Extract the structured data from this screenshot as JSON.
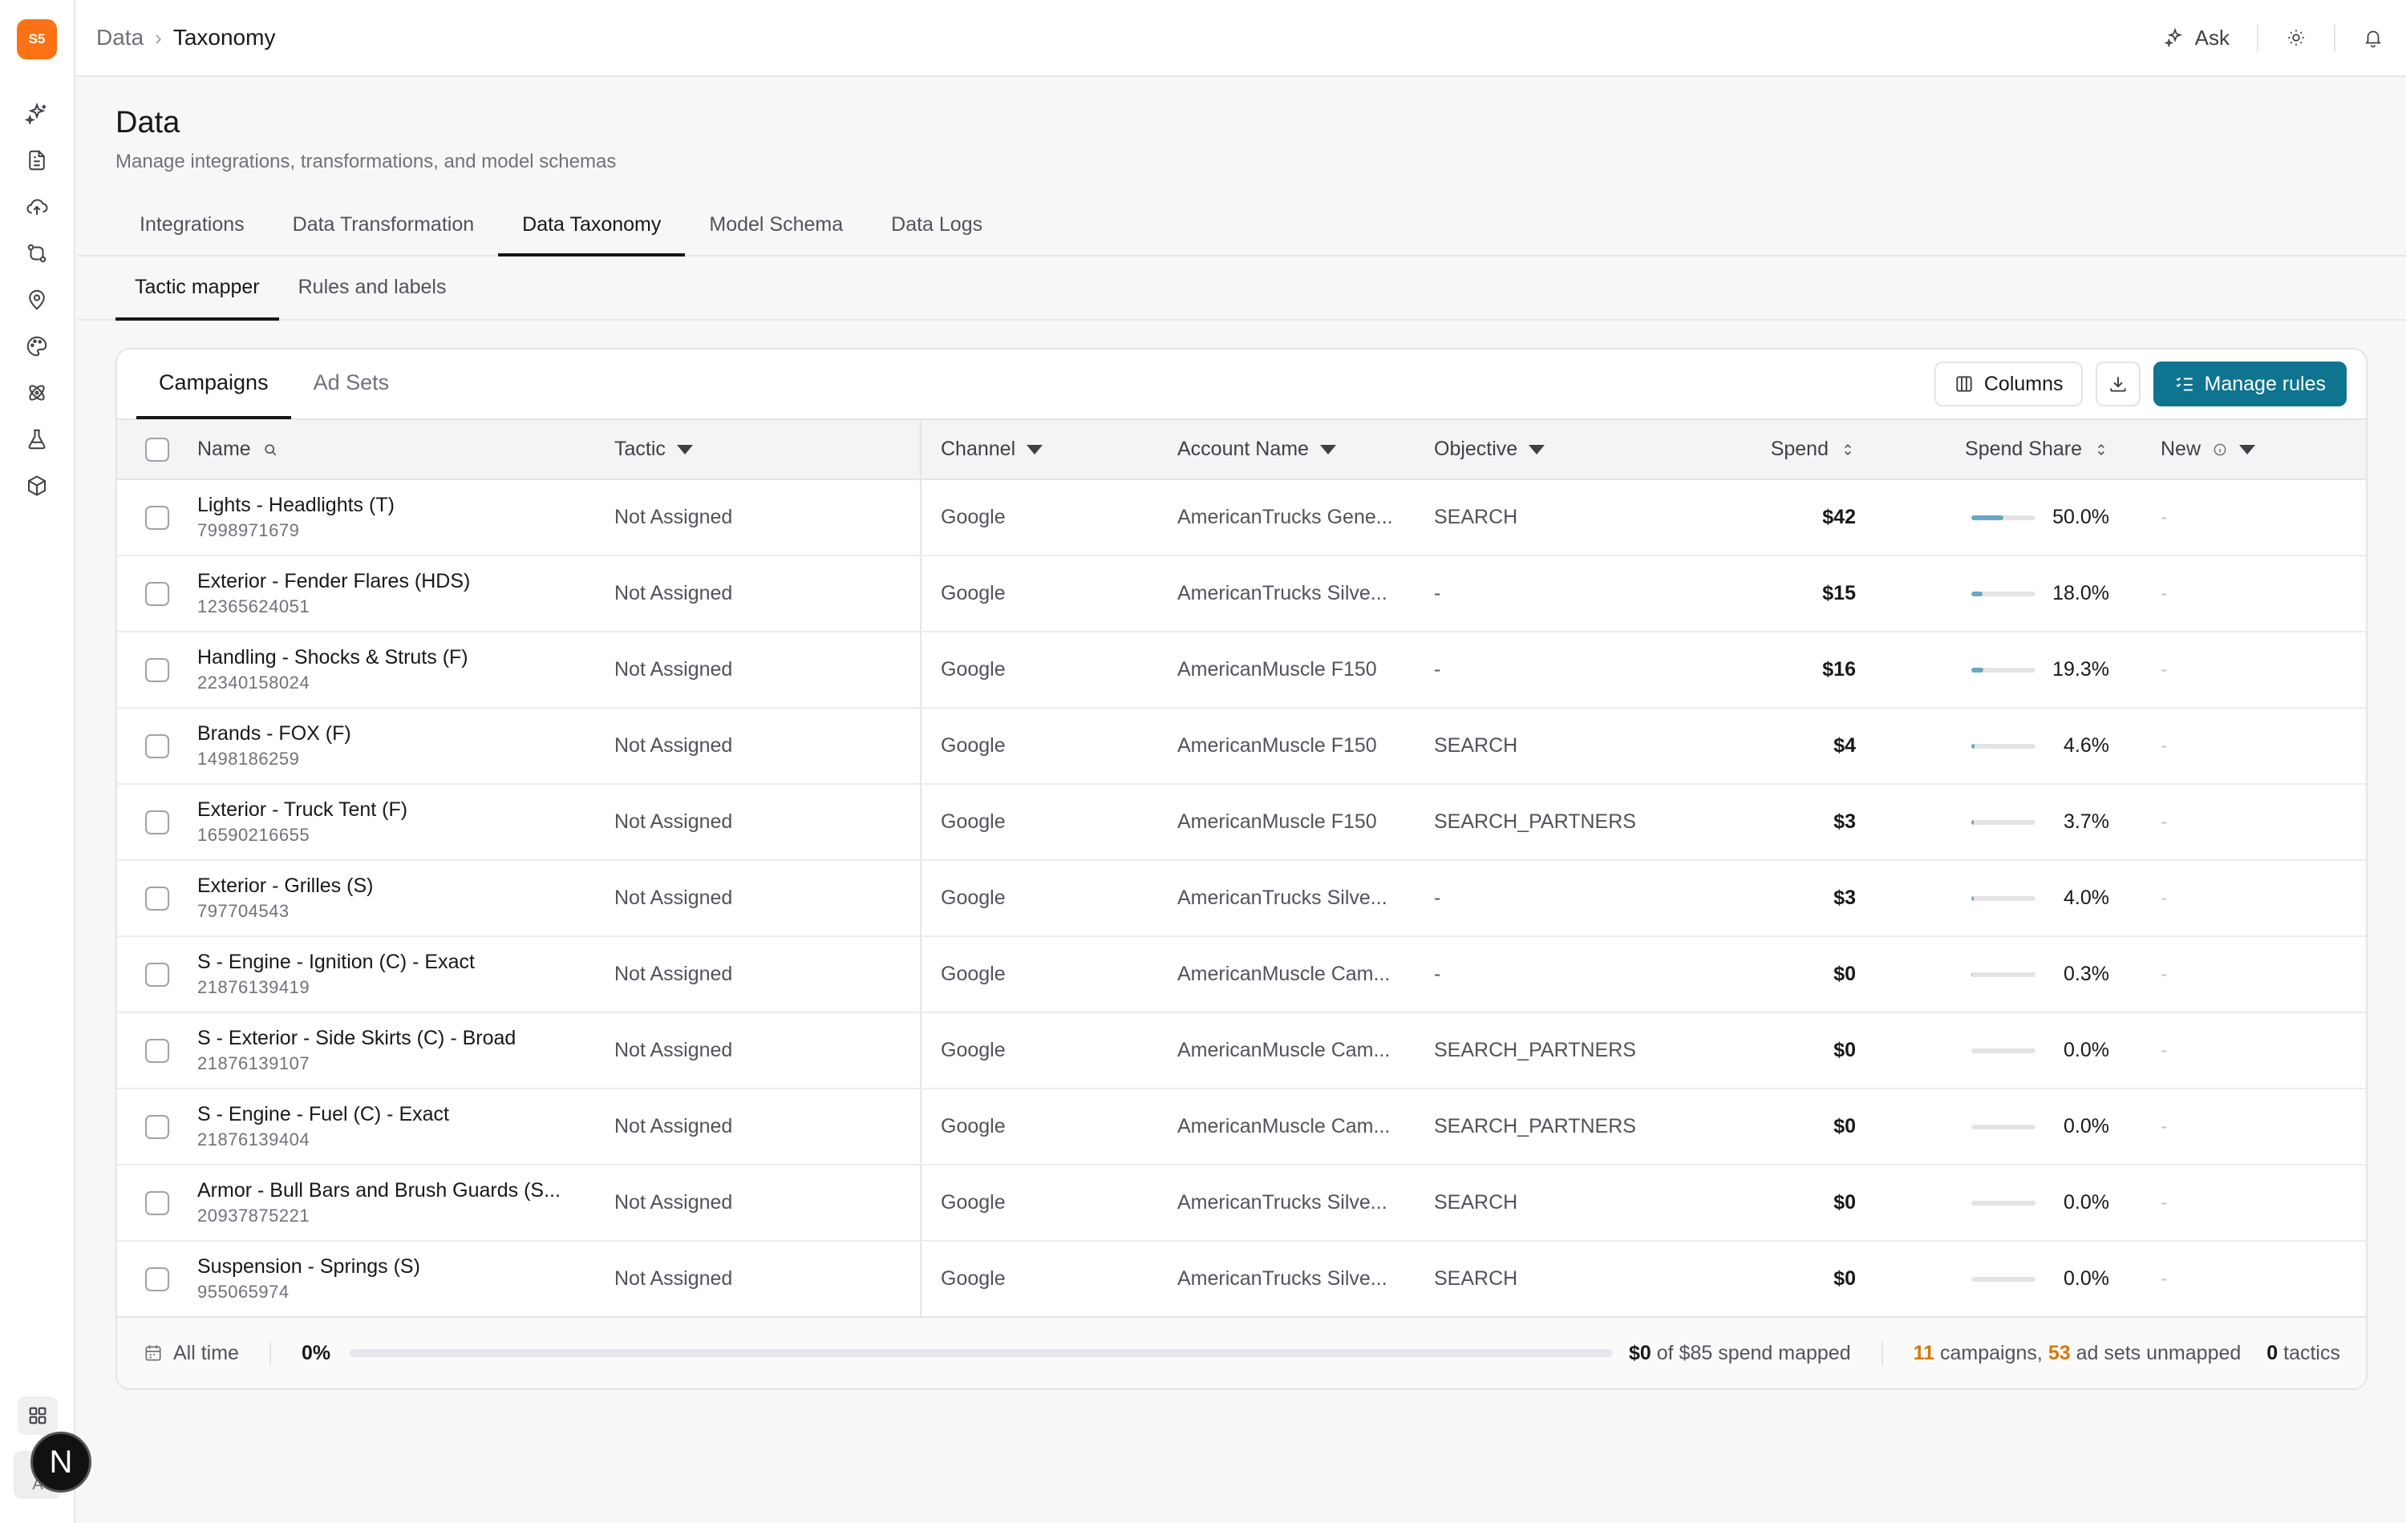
{
  "app": {
    "logo_text": "S5",
    "accent": "#0e7490",
    "logo_color": "#f97316"
  },
  "breadcrumb": {
    "root": "Data",
    "current": "Taxonomy"
  },
  "topbar": {
    "ask_label": "Ask"
  },
  "sidebar": {
    "icons": [
      "sparkles-icon",
      "document-icon",
      "cloud-upload-icon",
      "git-compare-icon",
      "map-pin-icon",
      "palette-icon",
      "atom-icon",
      "flask-icon",
      "cube-icon"
    ],
    "avatar_letter": "A",
    "badge_letter": "N"
  },
  "header": {
    "title": "Data",
    "subtitle": "Manage integrations, transformations, and model schemas"
  },
  "tabs": [
    "Integrations",
    "Data Transformation",
    "Data Taxonomy",
    "Model Schema",
    "Data Logs"
  ],
  "subtabs": [
    "Tactic mapper",
    "Rules and labels"
  ],
  "card": {
    "tabs": [
      "Campaigns",
      "Ad Sets"
    ],
    "columns_label": "Columns",
    "manage_rules_label": "Manage rules"
  },
  "table": {
    "headers": {
      "name": "Name",
      "tactic": "Tactic",
      "channel": "Channel",
      "account": "Account Name",
      "objective": "Objective",
      "spend": "Spend",
      "share": "Spend Share",
      "new": "New"
    },
    "rows": [
      {
        "name": "Lights - Headlights (T)",
        "id": "7998971679",
        "tactic": "Not Assigned",
        "channel": "Google",
        "account": "AmericanTrucks Gene...",
        "objective": "SEARCH",
        "spend": "$42",
        "share": "50.0%",
        "share_value": 50.0,
        "new": "-"
      },
      {
        "name": "Exterior - Fender Flares (HDS)",
        "id": "12365624051",
        "tactic": "Not Assigned",
        "channel": "Google",
        "account": "AmericanTrucks Silve...",
        "objective": "-",
        "spend": "$15",
        "share": "18.0%",
        "share_value": 18.0,
        "new": "-"
      },
      {
        "name": "Handling - Shocks & Struts (F)",
        "id": "22340158024",
        "tactic": "Not Assigned",
        "channel": "Google",
        "account": "AmericanMuscle F150",
        "objective": "-",
        "spend": "$16",
        "share": "19.3%",
        "share_value": 19.3,
        "new": "-"
      },
      {
        "name": "Brands - FOX (F)",
        "id": "1498186259",
        "tactic": "Not Assigned",
        "channel": "Google",
        "account": "AmericanMuscle F150",
        "objective": "SEARCH",
        "spend": "$4",
        "share": "4.6%",
        "share_value": 4.6,
        "new": "-"
      },
      {
        "name": "Exterior - Truck Tent (F)",
        "id": "16590216655",
        "tactic": "Not Assigned",
        "channel": "Google",
        "account": "AmericanMuscle F150",
        "objective": "SEARCH_PARTNERS",
        "spend": "$3",
        "share": "3.7%",
        "share_value": 3.7,
        "new": "-"
      },
      {
        "name": "Exterior - Grilles (S)",
        "id": "797704543",
        "tactic": "Not Assigned",
        "channel": "Google",
        "account": "AmericanTrucks Silve...",
        "objective": "-",
        "spend": "$3",
        "share": "4.0%",
        "share_value": 4.0,
        "new": "-"
      },
      {
        "name": "S - Engine - Ignition (C) - Exact",
        "id": "21876139419",
        "tactic": "Not Assigned",
        "channel": "Google",
        "account": "AmericanMuscle Cam...",
        "objective": "-",
        "spend": "$0",
        "share": "0.3%",
        "share_value": 0.3,
        "new": "-"
      },
      {
        "name": "S - Exterior - Side Skirts (C) - Broad",
        "id": "21876139107",
        "tactic": "Not Assigned",
        "channel": "Google",
        "account": "AmericanMuscle Cam...",
        "objective": "SEARCH_PARTNERS",
        "spend": "$0",
        "share": "0.0%",
        "share_value": 0.0,
        "new": "-"
      },
      {
        "name": "S - Engine - Fuel (C) - Exact",
        "id": "21876139404",
        "tactic": "Not Assigned",
        "channel": "Google",
        "account": "AmericanMuscle Cam...",
        "objective": "SEARCH_PARTNERS",
        "spend": "$0",
        "share": "0.0%",
        "share_value": 0.0,
        "new": "-"
      },
      {
        "name": "Armor - Bull Bars and Brush Guards (S...",
        "id": "20937875221",
        "tactic": "Not Assigned",
        "channel": "Google",
        "account": "AmericanTrucks Silve...",
        "objective": "SEARCH",
        "spend": "$0",
        "share": "0.0%",
        "share_value": 0.0,
        "new": "-"
      },
      {
        "name": "Suspension - Springs (S)",
        "id": "955065974",
        "tactic": "Not Assigned",
        "channel": "Google",
        "account": "AmericanTrucks Silve...",
        "objective": "SEARCH",
        "spend": "$0",
        "share": "0.0%",
        "share_value": 0.0,
        "new": "-"
      }
    ]
  },
  "footer": {
    "range_label": "All time",
    "percent": "0%",
    "percent_value": 0,
    "mapped_amount": "$0",
    "mapped_text": "of $85 spend mapped",
    "campaigns_count": "11",
    "campaigns_text": "campaigns,",
    "adsets_count": "53",
    "adsets_text": "ad sets unmapped",
    "tactics_count": "0",
    "tactics_text": "tactics"
  }
}
